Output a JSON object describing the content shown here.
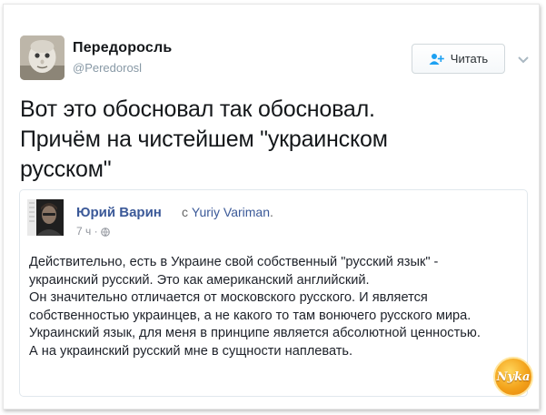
{
  "tweet": {
    "display_name": "Передоросль",
    "handle": "@Peredorosl",
    "follow_label": "Читать",
    "text_lines": [
      "Вот это обосновал так обосновал.",
      "Причём на чистейшем \"украинском",
      "русском\""
    ]
  },
  "quoted_post": {
    "author": "Юрий Варин",
    "via_prefix": "с",
    "via_name": "Yuriy Variman",
    "via_suffix": ".",
    "time": "7 ч ·",
    "body_lines": [
      "Действительно, есть в Украине свой собственный \"русский язык\" -",
      "украинский русский. Это как американский английский.",
      "Он значительно отличается от московского русского. И является",
      "собственностью украинцев, а не какого то там вонючего русского мира.",
      "Украинский язык, для меня в принципе является абсолютной ценностью.",
      "А на украинский русский мне в сущности наплевать."
    ]
  },
  "watermark": {
    "text": "Nyka"
  },
  "colors": {
    "accent_blue": "#1da1f2",
    "fb_blue": "#3b5998",
    "text_dark": "#14171a",
    "muted": "#8899a6"
  },
  "icons": {
    "follow": "add-user-icon",
    "caret": "chevron-down-icon",
    "privacy": "globe-icon"
  }
}
